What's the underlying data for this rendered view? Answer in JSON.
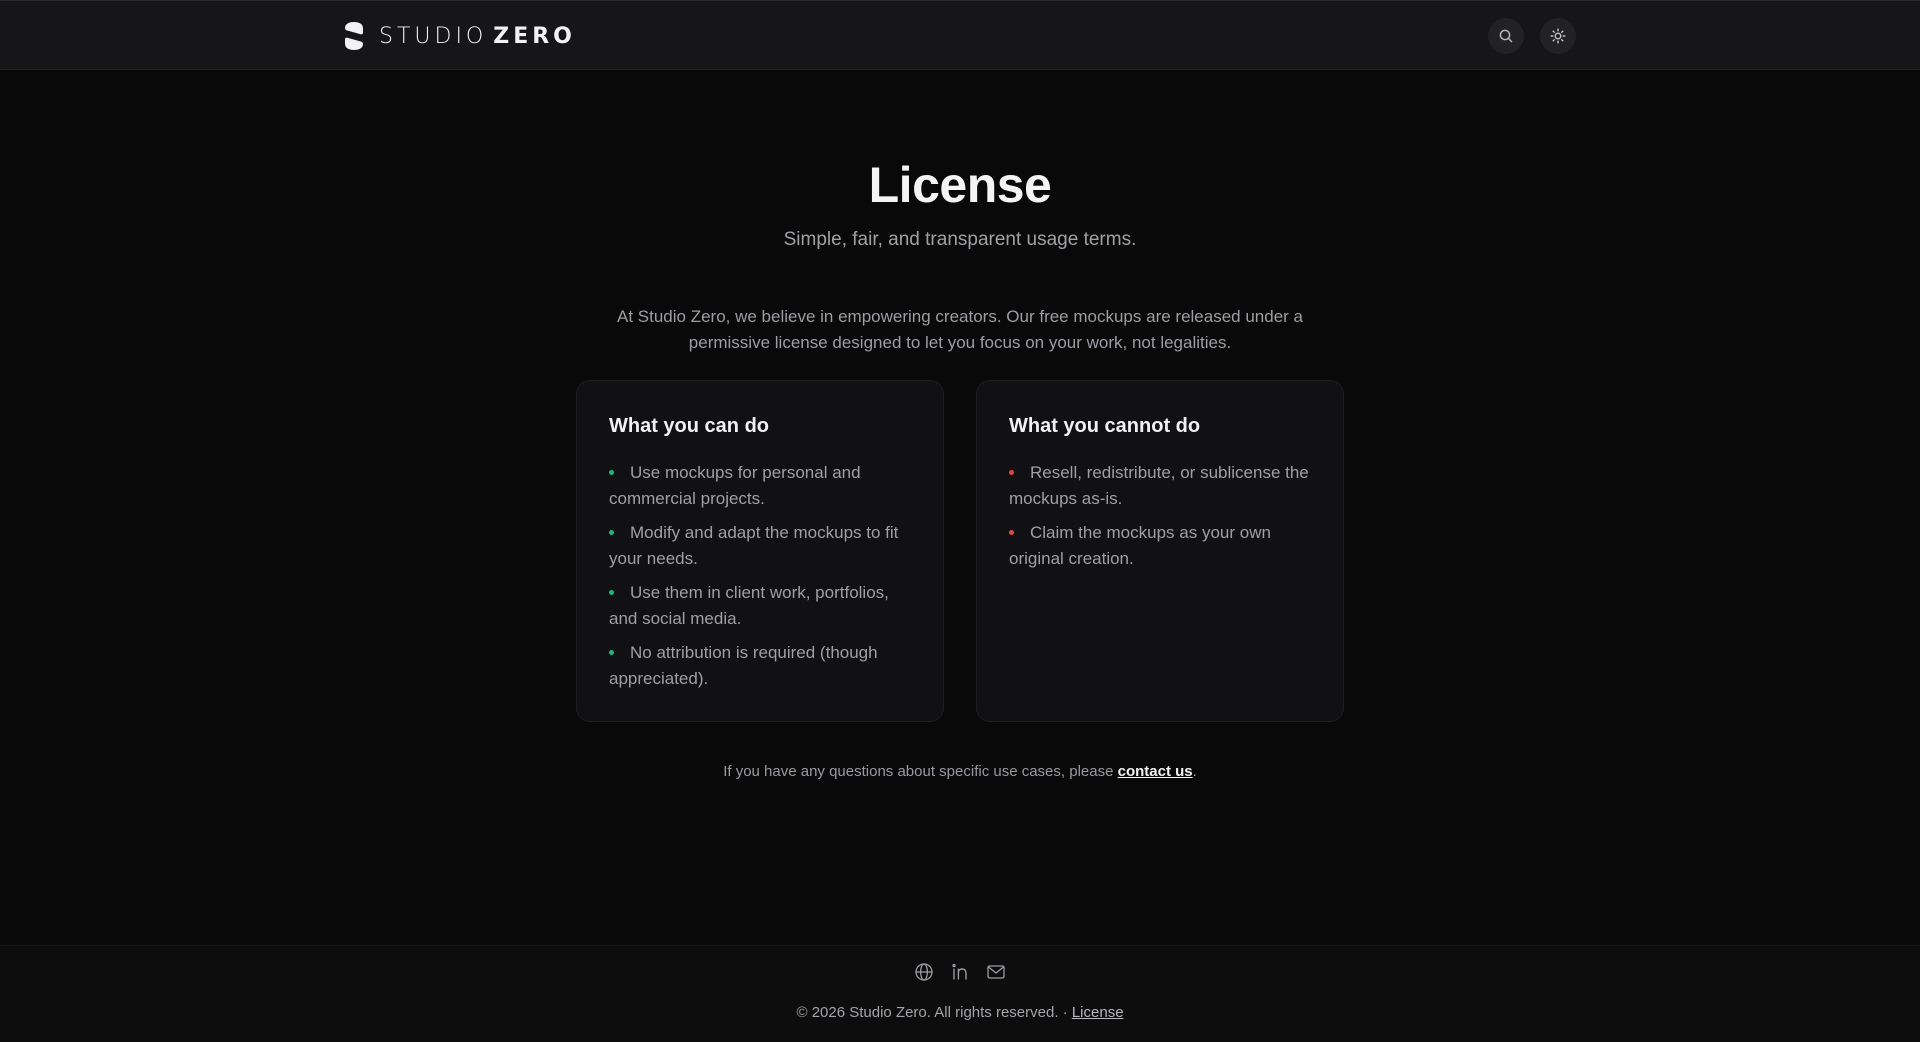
{
  "header": {
    "brand_primary": "STUDIO",
    "brand_secondary": "ZERO",
    "search_icon": "search-icon",
    "theme_icon": "sun-icon"
  },
  "main": {
    "title": "License",
    "subtitle": "Simple, fair, and transparent usage terms.",
    "intro": "At Studio Zero, we believe in empowering creators. Our free mockups are released under a permissive license designed to let you focus on your work, not legalities.",
    "can": {
      "heading": "What you can do",
      "items": [
        "Use mockups for personal and commercial projects.",
        "Modify and adapt the mockups to fit your needs.",
        "Use them in client work, portfolios, and social media.",
        "No attribution is required (though appreciated)."
      ]
    },
    "cannot": {
      "heading": "What you cannot do",
      "items": [
        "Resell, redistribute, or sublicense the mockups as-is.",
        "Claim the mockups as your own original creation."
      ]
    },
    "contact": {
      "prefix": "If you have any questions about specific use cases, please ",
      "link": "contact us",
      "suffix": "."
    }
  },
  "footer": {
    "social_icons": [
      "globe-icon",
      "linkedin-icon",
      "mail-icon"
    ],
    "copyright": "© 2026 Studio Zero. All rights reserved. · ",
    "license_link": "License"
  },
  "colors": {
    "background": "#09090a",
    "header_bg": "#161618",
    "card_bg": "#111113",
    "allowed_bullet": "#22b77a",
    "disallowed_bullet": "#e04848"
  }
}
